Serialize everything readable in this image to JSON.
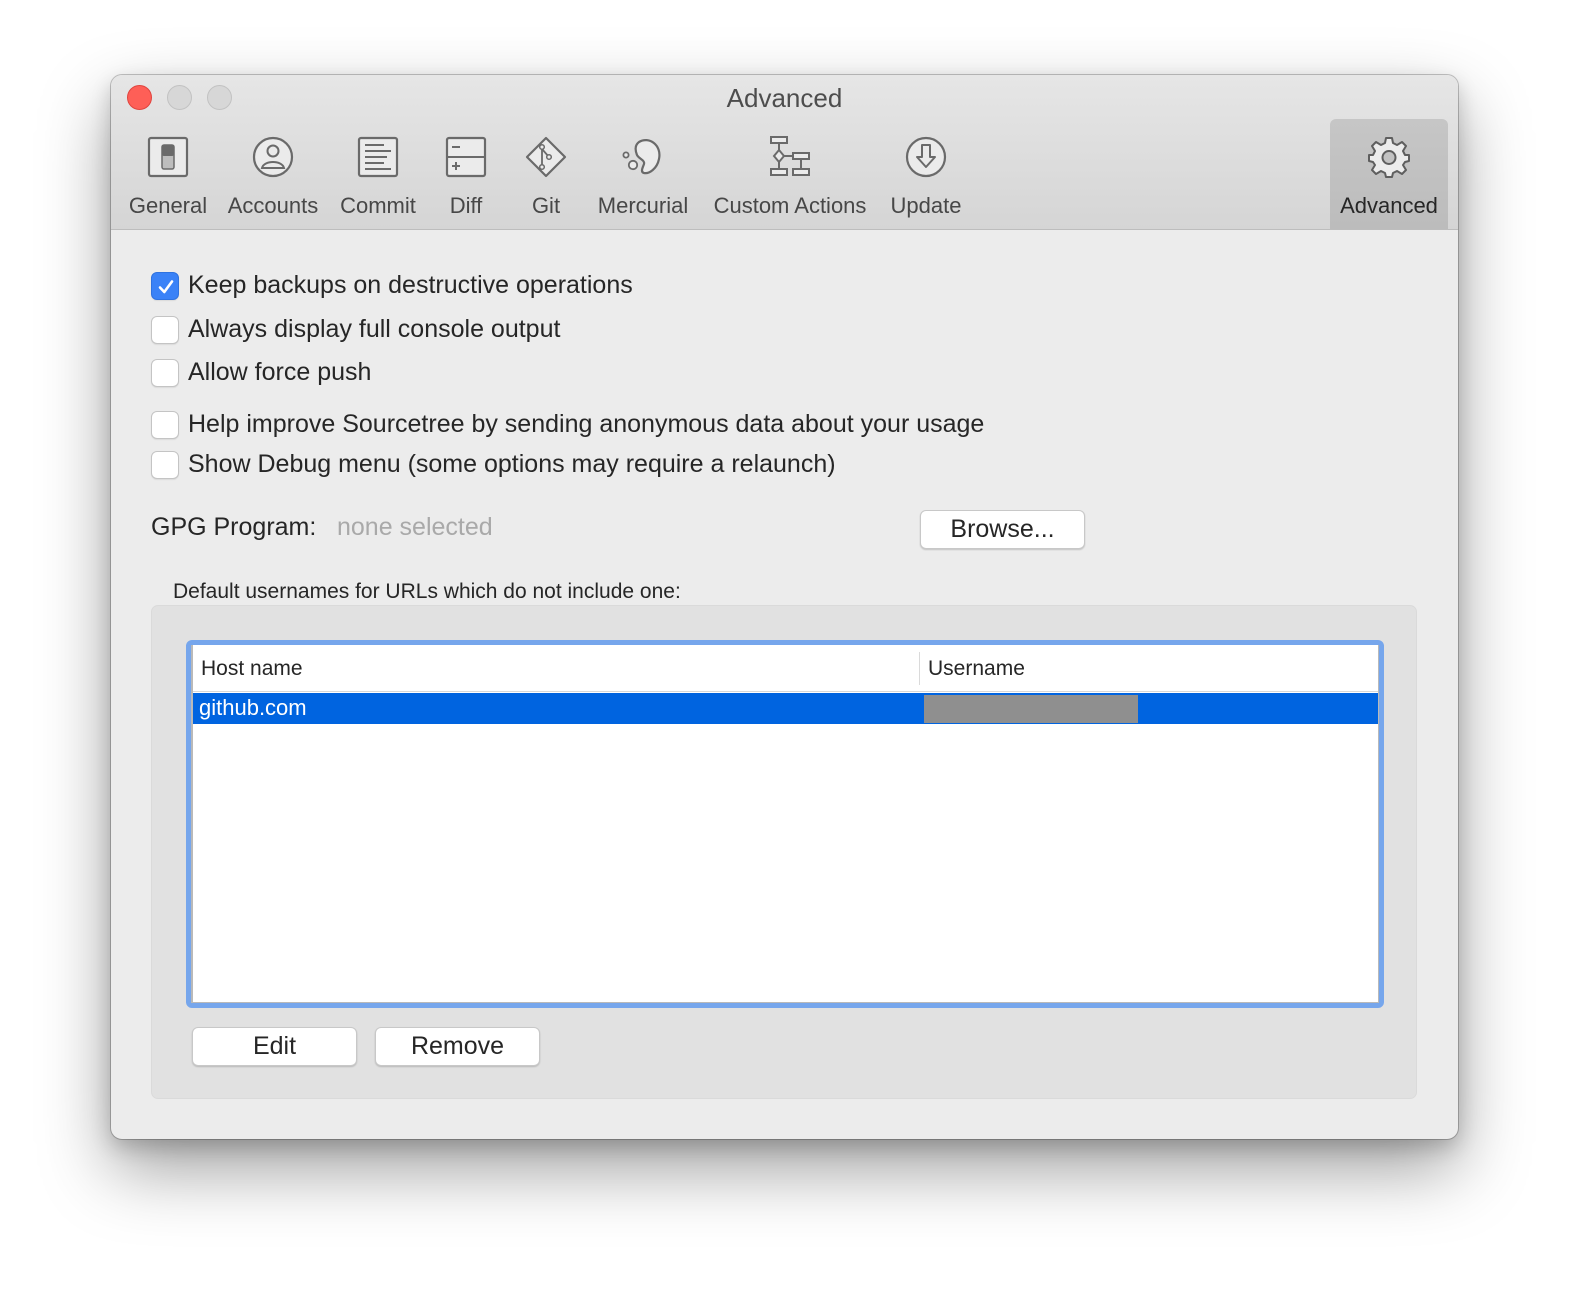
{
  "window": {
    "title": "Advanced",
    "traffic_lights": [
      "close",
      "minimize",
      "zoom"
    ]
  },
  "toolbar": {
    "items": [
      {
        "label": "General",
        "icon": "switch-icon",
        "active": false
      },
      {
        "label": "Accounts",
        "icon": "person-circle-icon",
        "active": false
      },
      {
        "label": "Commit",
        "icon": "document-lines-icon",
        "active": false
      },
      {
        "label": "Diff",
        "icon": "diff-icon",
        "active": false
      },
      {
        "label": "Git",
        "icon": "git-diamond-icon",
        "active": false
      },
      {
        "label": "Mercurial",
        "icon": "mercurial-icon",
        "active": false
      },
      {
        "label": "Custom Actions",
        "icon": "flowchart-icon",
        "active": false
      },
      {
        "label": "Update",
        "icon": "download-arrow-icon",
        "active": false
      },
      {
        "label": "Advanced",
        "icon": "gear-icon",
        "active": true
      }
    ]
  },
  "options": [
    {
      "label": "Keep backups on destructive operations",
      "checked": true
    },
    {
      "label": "Always display full console output",
      "checked": false
    },
    {
      "label": "Allow force push",
      "checked": false
    },
    {
      "label": "Help improve Sourcetree by sending anonymous data about your usage",
      "checked": false
    },
    {
      "label": "Show Debug menu (some options may require a relaunch)",
      "checked": false
    }
  ],
  "gpg": {
    "label": "GPG Program:",
    "value": "none selected",
    "browse_label": "Browse..."
  },
  "usernames": {
    "group_label": "Default usernames for URLs which do not include one:",
    "columns": [
      "Host name",
      "Username"
    ],
    "rows": [
      {
        "host": "github.com",
        "username": "[redacted]",
        "selected": true
      }
    ],
    "edit_label": "Edit",
    "remove_label": "Remove"
  },
  "colors": {
    "accent": "#3a82f7",
    "selection": "#0064e0",
    "focus_ring": "#76a6ec",
    "close_button": "#fe5f57"
  }
}
